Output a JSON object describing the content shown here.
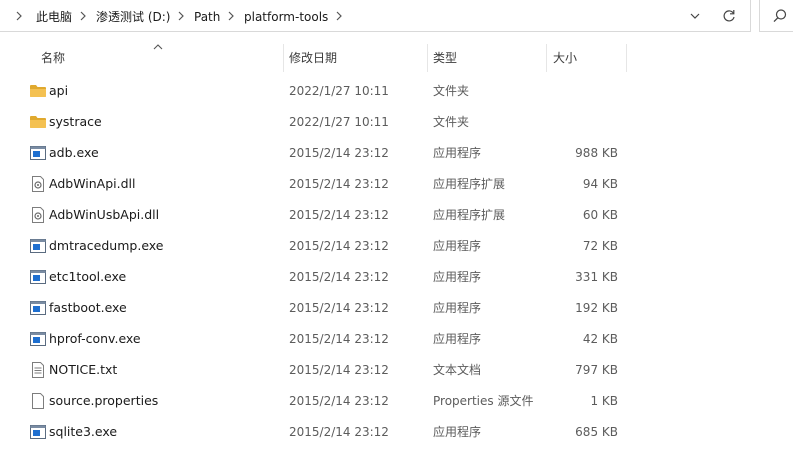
{
  "breadcrumb": [
    "此电脑",
    "渗透测试 (D:)",
    "Path",
    "platform-tools"
  ],
  "columns": {
    "name": "名称",
    "date": "修改日期",
    "type": "类型",
    "size": "大小"
  },
  "files": [
    {
      "name": "api",
      "date": "2022/1/27 10:11",
      "type": "文件夹",
      "size": "",
      "icon": "folder-icon"
    },
    {
      "name": "systrace",
      "date": "2022/1/27 10:11",
      "type": "文件夹",
      "size": "",
      "icon": "folder-icon"
    },
    {
      "name": "adb.exe",
      "date": "2015/2/14 23:12",
      "type": "应用程序",
      "size": "988 KB",
      "icon": "application-icon"
    },
    {
      "name": "AdbWinApi.dll",
      "date": "2015/2/14 23:12",
      "type": "应用程序扩展",
      "size": "94 KB",
      "icon": "dll-icon"
    },
    {
      "name": "AdbWinUsbApi.dll",
      "date": "2015/2/14 23:12",
      "type": "应用程序扩展",
      "size": "60 KB",
      "icon": "dll-icon"
    },
    {
      "name": "dmtracedump.exe",
      "date": "2015/2/14 23:12",
      "type": "应用程序",
      "size": "72 KB",
      "icon": "application-icon"
    },
    {
      "name": "etc1tool.exe",
      "date": "2015/2/14 23:12",
      "type": "应用程序",
      "size": "331 KB",
      "icon": "application-icon"
    },
    {
      "name": "fastboot.exe",
      "date": "2015/2/14 23:12",
      "type": "应用程序",
      "size": "192 KB",
      "icon": "application-icon"
    },
    {
      "name": "hprof-conv.exe",
      "date": "2015/2/14 23:12",
      "type": "应用程序",
      "size": "42 KB",
      "icon": "application-icon"
    },
    {
      "name": "NOTICE.txt",
      "date": "2015/2/14 23:12",
      "type": "文本文档",
      "size": "797 KB",
      "icon": "text-file-icon"
    },
    {
      "name": "source.properties",
      "date": "2015/2/14 23:12",
      "type": "Properties 源文件",
      "size": "1 KB",
      "icon": "file-icon"
    },
    {
      "name": "sqlite3.exe",
      "date": "2015/2/14 23:12",
      "type": "应用程序",
      "size": "685 KB",
      "icon": "application-icon"
    }
  ],
  "colors": {
    "folder": "#f4c152",
    "folder_dark": "#e0a92e",
    "app_blue": "#1e6fd0",
    "divider": "#e6e6e6"
  }
}
